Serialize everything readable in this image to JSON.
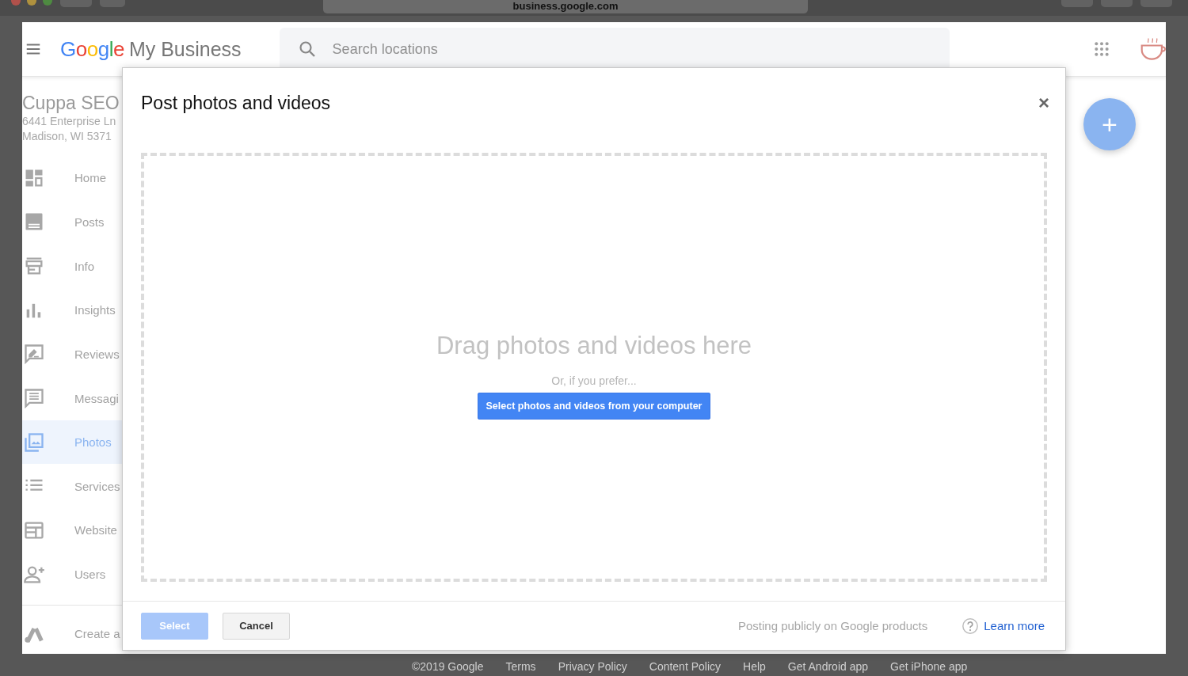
{
  "browser": {
    "address": "business.google.com"
  },
  "header": {
    "logo": "Google",
    "product": "My Business",
    "search": {
      "placeholder": "Search locations"
    }
  },
  "business": {
    "name": "Cuppa SEO",
    "address_lines": [
      "6441 Enterprise Ln",
      "Madison, WI 5371"
    ]
  },
  "sidebar": {
    "items": [
      {
        "kind": "home",
        "label": "Home",
        "selected": false
      },
      {
        "kind": "posts",
        "label": "Posts",
        "selected": false
      },
      {
        "kind": "info",
        "label": "Info",
        "selected": false
      },
      {
        "kind": "insights",
        "label": "Insights",
        "selected": false
      },
      {
        "kind": "reviews",
        "label": "Reviews",
        "selected": false
      },
      {
        "kind": "messaging",
        "label": "Messagi",
        "selected": false
      },
      {
        "kind": "photos",
        "label": "Photos",
        "selected": true
      },
      {
        "kind": "services",
        "label": "Services",
        "selected": false
      },
      {
        "kind": "website",
        "label": "Website",
        "selected": false
      },
      {
        "kind": "users",
        "label": "Users",
        "selected": false
      }
    ],
    "extra": {
      "kind": "ads",
      "label": "Create a"
    }
  },
  "fab": {
    "label": "+"
  },
  "dialog": {
    "title": "Post photos and videos",
    "close": "×",
    "dropzone": {
      "heading": "Drag photos and videos here",
      "hint": "Or, if you prefer...",
      "button": "Select photos and videos from your computer"
    },
    "buttons": [
      {
        "label": "Select",
        "disabled": true
      },
      {
        "label": "Cancel",
        "disabled": false
      }
    ],
    "notice": "Posting publicly on Google products",
    "link": "Learn more"
  },
  "footer": [
    "©2019 Google",
    "Terms",
    "Privacy Policy",
    "Content Policy",
    "Help",
    "Get Android app",
    "Get iPhone app"
  ]
}
